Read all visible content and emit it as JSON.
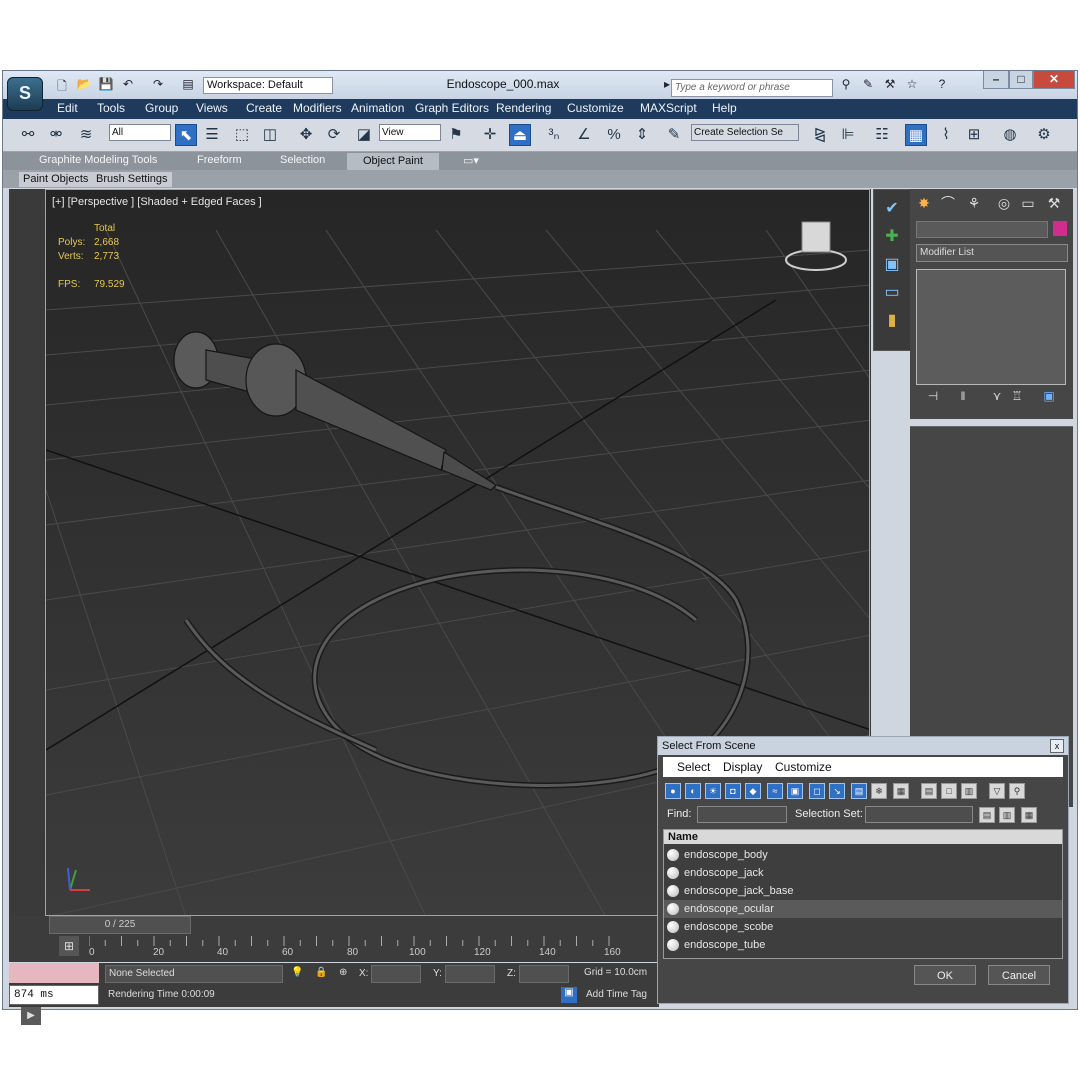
{
  "window": {
    "title": "Endoscope_000.max",
    "app_logo": "S",
    "workspace": "Workspace: Default",
    "search_placeholder": "Type a keyword or phrase",
    "minimize": "–",
    "maximize": "□",
    "close": "✕"
  },
  "menu": [
    "Edit",
    "Tools",
    "Group",
    "Views",
    "Create",
    "Modifiers",
    "Animation",
    "Graph Editors",
    "Rendering",
    "Customize",
    "MAXScript",
    "Help"
  ],
  "toolbar": {
    "selection_filter": "All",
    "ref_coord": "View",
    "named_selection": "Create Selection Se"
  },
  "ribbon": {
    "tabs": [
      "Graphite Modeling Tools",
      "Freeform",
      "Selection",
      "Object Paint"
    ],
    "active_tab": "Object Paint",
    "subtabs": [
      "Paint Objects",
      "Brush Settings"
    ]
  },
  "viewport": {
    "label": "[+] [Perspective ] [Shaded + Edged Faces ]",
    "stats": {
      "header": "Total",
      "polys_label": "Polys:",
      "polys": "2,668",
      "verts_label": "Verts:",
      "verts": "2,773",
      "fps_label": "FPS:",
      "fps": "79.529"
    }
  },
  "command_panel": {
    "modifier_list": "Modifier List",
    "color_swatch": "#d22c8c"
  },
  "timeline": {
    "slider": "0 / 225",
    "ticks": [
      "0",
      "20",
      "40",
      "60",
      "80",
      "100",
      "120",
      "140",
      "160"
    ]
  },
  "status": {
    "selection": "None Selected",
    "x_label": "X:",
    "y_label": "Y:",
    "z_label": "Z:",
    "grid": "Grid = 10.0cm",
    "rendering_time": "Rendering Time  0:00:09",
    "add_time_tag": "Add Time Tag",
    "ms": "874 ms"
  },
  "dialog": {
    "title": "Select From Scene",
    "close": "x",
    "menu": [
      "Select",
      "Display",
      "Customize"
    ],
    "find_label": "Find:",
    "selection_set_label": "Selection Set:",
    "column_name": "Name",
    "objects": [
      "endoscope_body",
      "endoscope_jack",
      "endoscope_jack_base",
      "endoscope_ocular",
      "endoscope_scobe",
      "endoscope_tube"
    ],
    "selected_index": 3,
    "ok": "OK",
    "cancel": "Cancel"
  },
  "colors": {
    "menubar": "#1e3b5e",
    "viewport_border": "#c6a63e",
    "stats_text": "#e3c84f",
    "toolbar_active": "#2f6fc4"
  }
}
